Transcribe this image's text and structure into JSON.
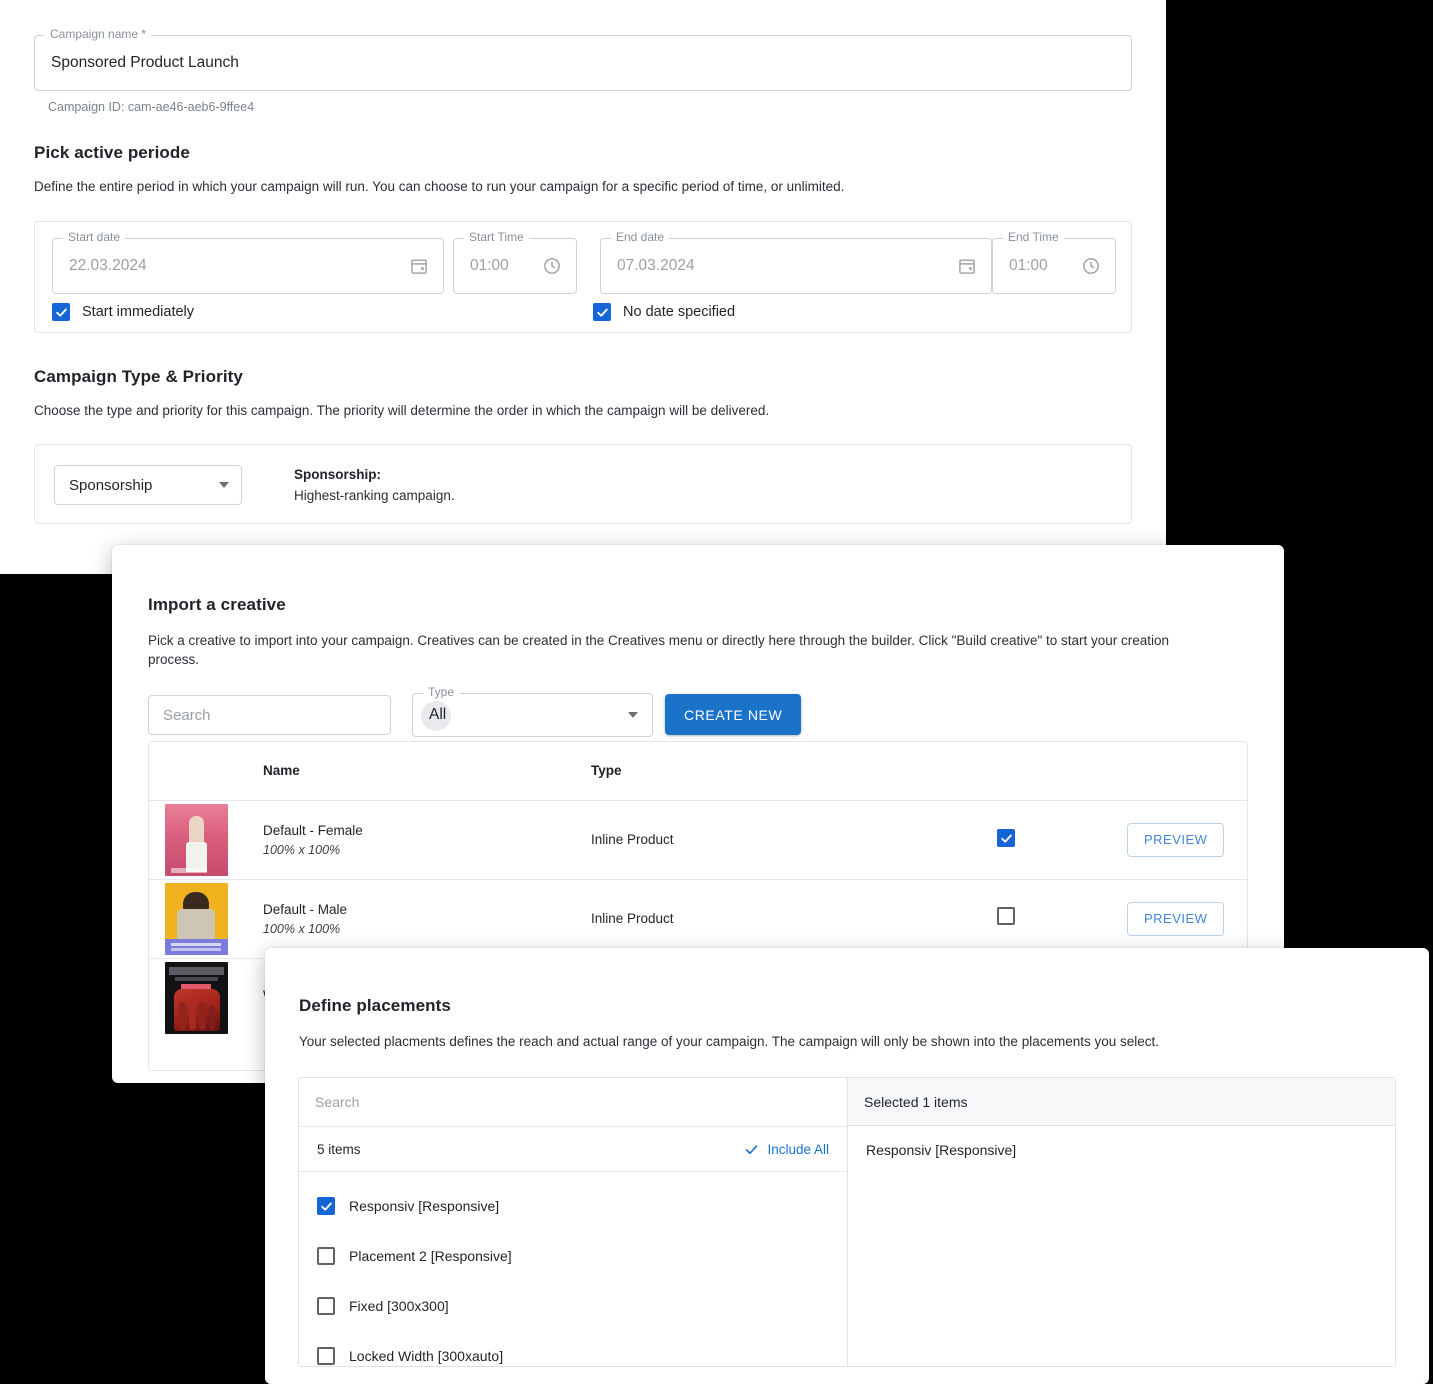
{
  "campaign": {
    "name_field": {
      "legend": "Campaign name *",
      "value": "Sponsored Product Launch"
    },
    "campaign_id_text": "Campaign ID: cam-ae46-aeb6-9ffee4",
    "active_period": {
      "title": "Pick active periode",
      "description": "Define the entire period in which your campaign will run. You can choose to run your campaign for a specific period of time, or unlimited.",
      "start_date": {
        "legend": "Start date",
        "value": "22.03.2024"
      },
      "start_time": {
        "legend": "Start Time",
        "value": "01:00"
      },
      "end_date": {
        "legend": "End date",
        "value": "07.03.2024"
      },
      "end_time": {
        "legend": "End Time",
        "value": "01:00"
      },
      "start_immediately": {
        "label": "Start immediately",
        "checked": true
      },
      "no_date_specified": {
        "label": "No date specified",
        "checked": true
      }
    },
    "type_priority": {
      "title": "Campaign Type & Priority",
      "description": "Choose the type and priority for this campaign. The priority will determine the order in which the campaign will be delivered.",
      "select_value": "Sponsorship",
      "info_title": "Sponsorship:",
      "info_text": "Highest-ranking campaign."
    }
  },
  "creative": {
    "title": "Import a creative",
    "description": "Pick a creative to import into your campaign. Creatives can be created in the Creatives menu or directly here through the builder. Click \"Build creative\" to start your creation process.",
    "search_placeholder": "Search",
    "type_select": {
      "legend": "Type",
      "value": "All"
    },
    "create_new_label": "CREATE NEW",
    "columns": {
      "name": "Name",
      "type": "Type"
    },
    "rows": [
      {
        "name": "Default - Female",
        "dims": "100% x 100%",
        "type": "Inline Product",
        "checked": true,
        "preview_label": "PREVIEW",
        "thumb": "pink"
      },
      {
        "name": "Default - Male",
        "dims": "100% x 100%",
        "type": "Inline Product",
        "checked": false,
        "preview_label": "PREVIEW",
        "thumb": "yellow"
      },
      {
        "name": "W",
        "dims": "",
        "type": "",
        "checked": false,
        "preview_label": "",
        "thumb": "dark"
      }
    ]
  },
  "placements": {
    "title": "Define placements",
    "description": "Your selected placments defines the reach and actual range of your campaign. The campaign will only be shown into the placements you select.",
    "search_placeholder": "Search",
    "items_count_label": "5 items",
    "include_all_label": "Include All",
    "selected_header": "Selected 1 items",
    "items": [
      {
        "label": "Responsiv [Responsive]",
        "checked": true
      },
      {
        "label": "Placement 2 [Responsive]",
        "checked": false
      },
      {
        "label": "Fixed [300x300]",
        "checked": false
      },
      {
        "label": "Locked Width [300xauto]",
        "checked": false
      }
    ],
    "selected_items": [
      "Responsiv [Responsive]"
    ]
  },
  "colors": {
    "accent_blue": "#1a73c9",
    "checkbox_blue": "#1565d8",
    "link_blue": "#4285dd",
    "text_dark": "#1f2328",
    "text_muted": "#9aa0a6"
  }
}
